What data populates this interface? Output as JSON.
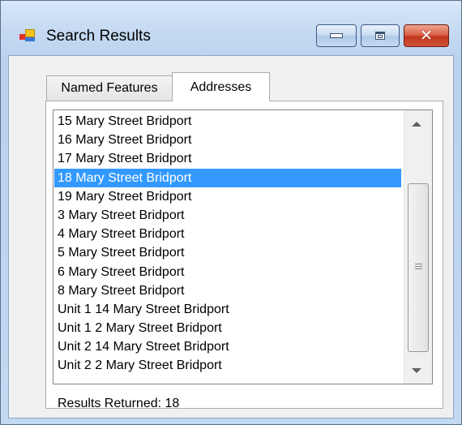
{
  "window": {
    "title": "Search Results",
    "icon": "app-form-icon",
    "controls": [
      "minimize-icon",
      "maximize-icon",
      "close-icon"
    ]
  },
  "tabs": [
    {
      "label": "Named Features",
      "selected": false
    },
    {
      "label": "Addresses",
      "selected": true
    }
  ],
  "list": {
    "items": [
      "15 Mary Street Bridport",
      "16 Mary Street Bridport",
      "17 Mary Street Bridport",
      "18 Mary Street Bridport",
      "19 Mary Street Bridport",
      "3 Mary Street Bridport",
      "4 Mary Street Bridport",
      "5 Mary Street Bridport",
      "6 Mary Street Bridport",
      "8 Mary Street Bridport",
      "Unit 1 14 Mary Street Bridport",
      "Unit 1 2 Mary Street Bridport",
      "Unit 2 14 Mary Street Bridport",
      "Unit 2 2 Mary Street Bridport"
    ],
    "selected_item": "18 Mary Street Bridport",
    "selection_color": "#3399ff"
  },
  "status": {
    "results_text": "Results Returned: 18"
  },
  "colors": {
    "close_button": "#c8432a",
    "title_gradient": "#c4d9f1"
  }
}
